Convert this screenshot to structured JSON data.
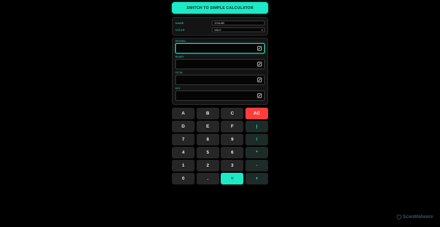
{
  "header": {
    "switch_label": "SWITCH TO SIMPLE CALCULATOR"
  },
  "settings": {
    "name_label": "NAME",
    "name_value": "SHAUBE",
    "voice_label": "VOICE",
    "voice_value": "MALE"
  },
  "bases": [
    {
      "label": "DECIMAL",
      "value": "",
      "active": true
    },
    {
      "label": "BINARY",
      "value": ""
    },
    {
      "label": "OCTAL",
      "value": ""
    },
    {
      "label": "HEX",
      "value": ""
    }
  ],
  "keys": [
    {
      "label": "A",
      "type": "normal",
      "name": "key-a"
    },
    {
      "label": "B",
      "type": "normal",
      "name": "key-b"
    },
    {
      "label": "C",
      "type": "normal",
      "name": "key-c"
    },
    {
      "label": "AC",
      "type": "clear",
      "name": "all-clear-button"
    },
    {
      "label": "D",
      "type": "normal",
      "name": "key-d"
    },
    {
      "label": "E",
      "type": "normal",
      "name": "key-e"
    },
    {
      "label": "F",
      "type": "normal",
      "name": "key-f"
    },
    {
      "label": "|",
      "type": "op",
      "name": "key-pipe"
    },
    {
      "label": "7",
      "type": "normal",
      "name": "key-7"
    },
    {
      "label": "8",
      "type": "normal",
      "name": "key-8"
    },
    {
      "label": "9",
      "type": "normal",
      "name": "key-9"
    },
    {
      "label": "/",
      "type": "op",
      "name": "divide-button"
    },
    {
      "label": "4",
      "type": "normal",
      "name": "key-4"
    },
    {
      "label": "5",
      "type": "normal",
      "name": "key-5"
    },
    {
      "label": "6",
      "type": "normal",
      "name": "key-6"
    },
    {
      "label": "*",
      "type": "op",
      "name": "multiply-button"
    },
    {
      "label": "1",
      "type": "normal",
      "name": "key-1"
    },
    {
      "label": "2",
      "type": "normal",
      "name": "key-2"
    },
    {
      "label": "3",
      "type": "normal",
      "name": "key-3"
    },
    {
      "label": "-",
      "type": "op",
      "name": "subtract-button"
    },
    {
      "label": "0",
      "type": "normal",
      "name": "key-0"
    },
    {
      "label": ".",
      "type": "normal",
      "name": "decimal-point-button"
    },
    {
      "label": "=",
      "type": "equals",
      "name": "equals-button"
    },
    {
      "label": "+",
      "type": "op",
      "name": "add-button"
    }
  ],
  "watermark": {
    "text": "ScanMalware",
    "icon": "shield-icon"
  },
  "colors": {
    "accent": "#1de9c6",
    "clear": "#ff3d3d",
    "background": "#000000"
  }
}
